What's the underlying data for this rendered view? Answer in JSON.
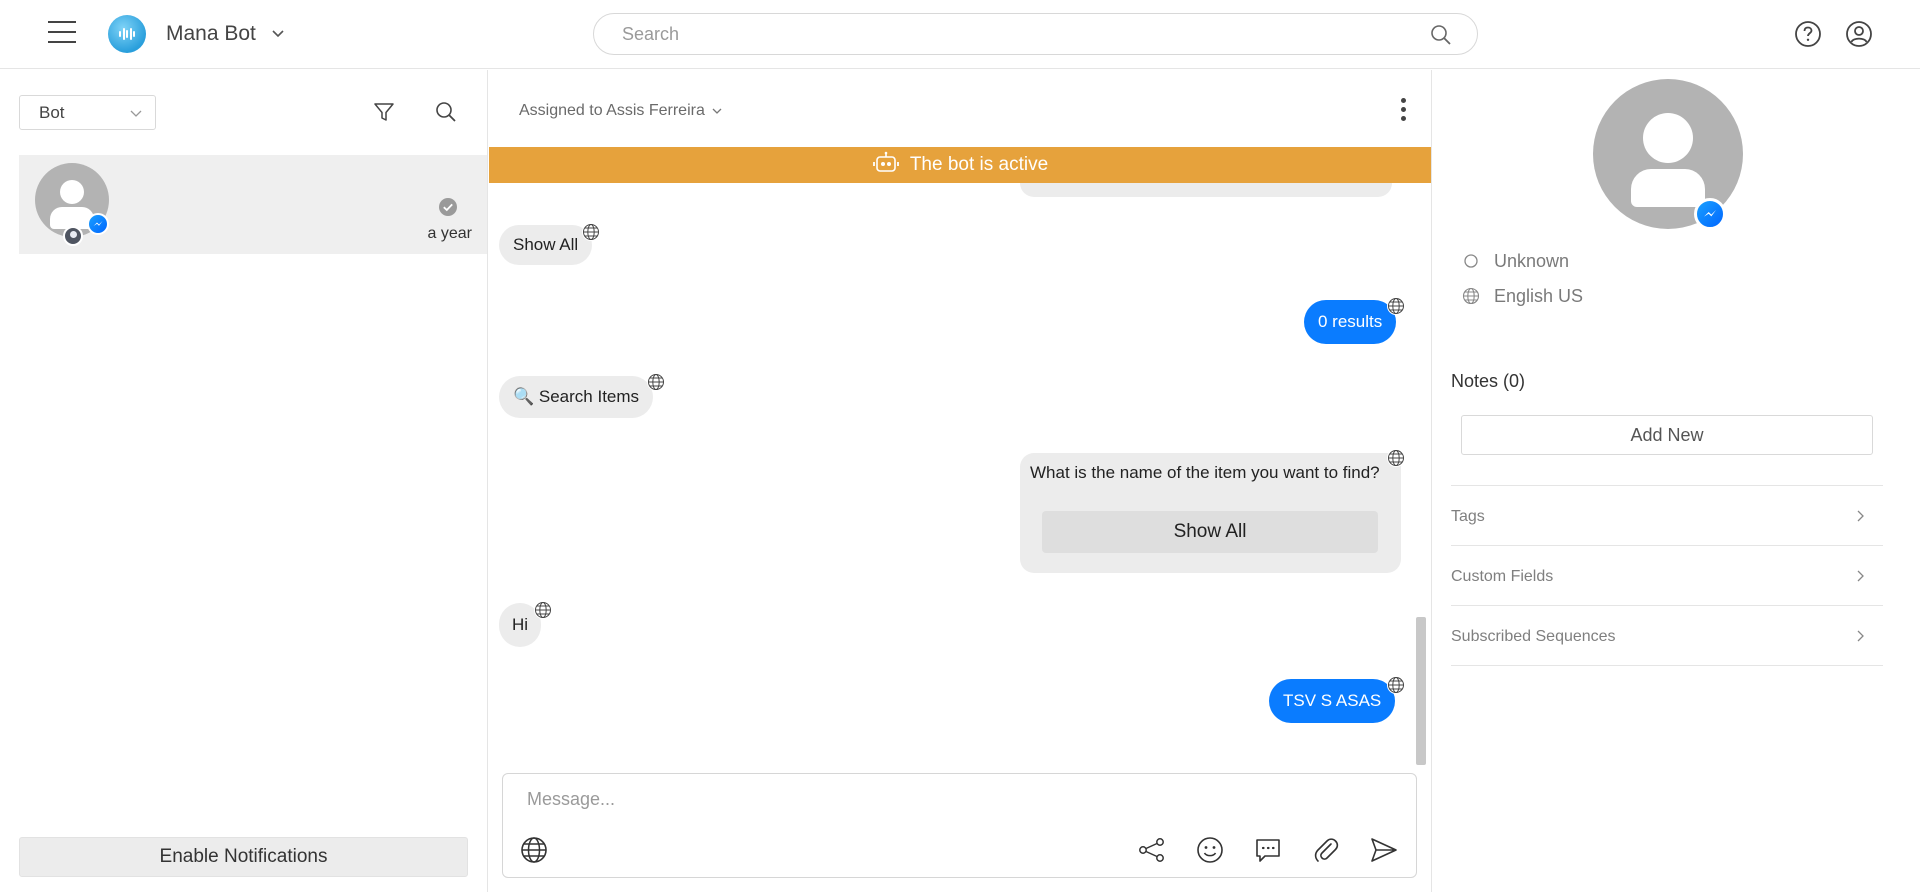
{
  "header": {
    "bot_name": "Mana Bot",
    "search_placeholder": "Search",
    "icons": [
      "menu-icon",
      "app-logo",
      "chevron-down-icon",
      "search-icon",
      "help-icon",
      "user-icon"
    ]
  },
  "left_panel": {
    "filter_value": "Bot",
    "conversations": [
      {
        "time": "a year",
        "channel": "messenger",
        "status": "checked"
      }
    ],
    "enable_notifications_label": "Enable Notifications"
  },
  "chat": {
    "assigned_label": "Assigned to Assis Ferreira",
    "bot_banner": "The bot is active",
    "messages": [
      {
        "direction": "in",
        "text": "Show All"
      },
      {
        "direction": "out",
        "text": "0 results"
      },
      {
        "direction": "in",
        "text": "🔍 Search Items"
      },
      {
        "direction": "out",
        "text": "What is the name of the item you want to find?",
        "button": "Show All"
      },
      {
        "direction": "in",
        "text": "Hi"
      },
      {
        "direction": "out",
        "text": "TSV S ASAS"
      }
    ],
    "composer_placeholder": "Message...",
    "composer_icons": [
      "globe-icon",
      "flow-icon",
      "emoji-icon",
      "chat-icon",
      "attachment-icon",
      "send-icon"
    ]
  },
  "contact": {
    "status": "Unknown",
    "language": "English US",
    "notes_title": "Notes (0)",
    "add_new_label": "Add New",
    "sections": [
      "Tags",
      "Custom Fields",
      "Subscribed Sequences"
    ]
  },
  "colors": {
    "accent": "#0a7cff",
    "banner": "#e6a23c",
    "bubble_in": "#ececec",
    "messenger": "#0a7cff"
  }
}
